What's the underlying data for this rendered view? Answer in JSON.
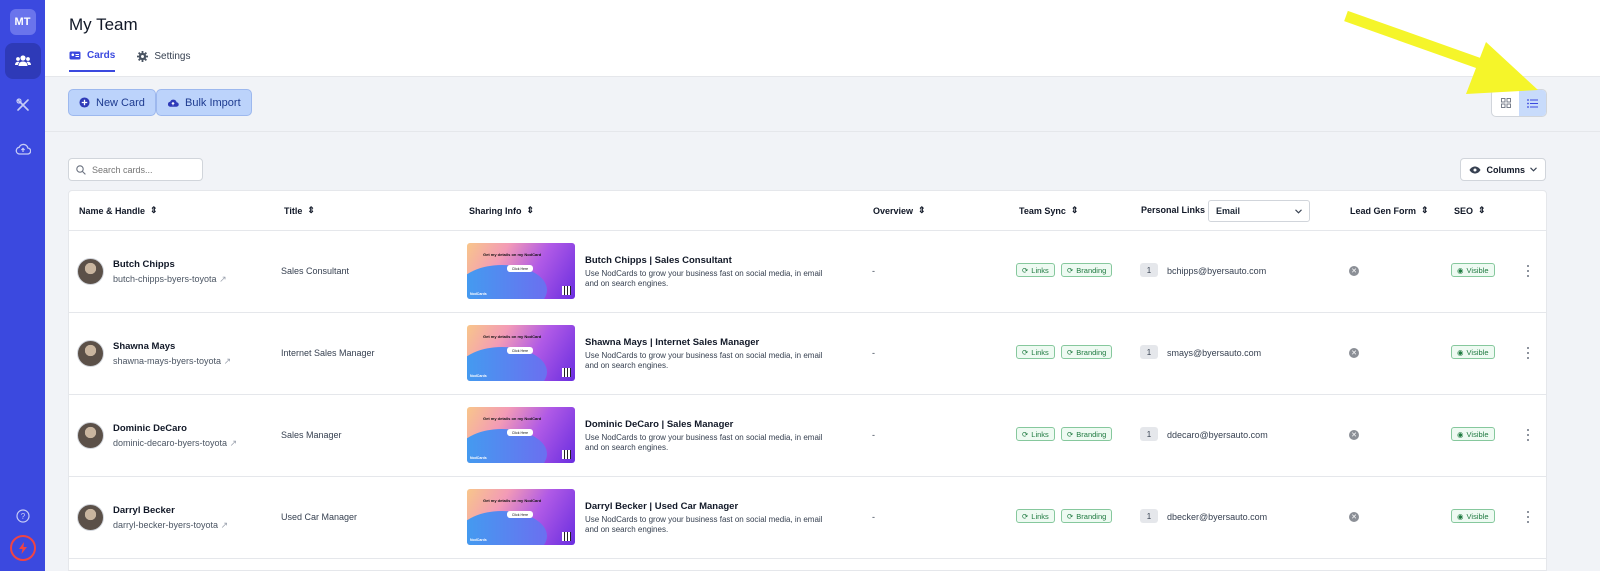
{
  "sidebar": {
    "avatar_initials": "MT",
    "items": [
      {
        "icon": "team-icon",
        "active": true
      },
      {
        "icon": "tools-icon",
        "active": false
      },
      {
        "icon": "cloud-upload-icon",
        "active": false
      }
    ],
    "bottom": [
      {
        "icon": "help-icon"
      },
      {
        "icon": "bolt-icon"
      }
    ]
  },
  "header": {
    "title": "My Team",
    "tabs": [
      {
        "label": "Cards",
        "icon": "id-card-icon",
        "active": true
      },
      {
        "label": "Settings",
        "icon": "gear-icon",
        "active": false
      }
    ]
  },
  "toolbar": {
    "new_card_label": "New Card",
    "bulk_import_label": "Bulk Import",
    "view_mode": "list"
  },
  "search": {
    "placeholder": "Search cards..."
  },
  "columns_button": {
    "label": "Columns"
  },
  "table": {
    "headers": {
      "name": "Name & Handle",
      "title": "Title",
      "sharing": "Sharing Info",
      "overview": "Overview",
      "team_sync": "Team Sync",
      "personal_links": "Personal Links",
      "personal_links_select": "Email",
      "lead_gen": "Lead Gen Form",
      "seo": "SEO"
    },
    "card_preview": {
      "cta": "Get my details on my NodCard",
      "button": "Click Here",
      "brand": "NodCards"
    },
    "chips": {
      "links": "Links",
      "branding": "Branding",
      "visible": "Visible"
    },
    "description": "Use NodCards to grow your business fast on social media, in email and on search engines.",
    "rows": [
      {
        "name": "Butch Chipps",
        "handle": "butch-chipps-byers-toyota",
        "title": "Sales Consultant",
        "share_title": "Butch Chipps | Sales Consultant",
        "overview": "-",
        "links_count": "1",
        "email": "bchipps@byersauto.com"
      },
      {
        "name": "Shawna Mays",
        "handle": "shawna-mays-byers-toyota",
        "title": "Internet Sales Manager",
        "share_title": "Shawna Mays | Internet Sales Manager",
        "overview": "-",
        "links_count": "1",
        "email": "smays@byersauto.com"
      },
      {
        "name": "Dominic DeCaro",
        "handle": "dominic-decaro-byers-toyota",
        "title": "Sales Manager",
        "share_title": "Dominic DeCaro | Sales Manager",
        "overview": "-",
        "links_count": "1",
        "email": "ddecaro@byersauto.com"
      },
      {
        "name": "Darryl Becker",
        "handle": "darryl-becker-byers-toyota",
        "title": "Used Car Manager",
        "share_title": "Darryl Becker | Used Car Manager",
        "overview": "-",
        "links_count": "1",
        "email": "dbecker@byersauto.com"
      }
    ]
  },
  "colors": {
    "sidebar": "#3b49df",
    "accent": "#3b49df",
    "arrow": "#f5f52a",
    "chip_green": "#1f7a40"
  }
}
